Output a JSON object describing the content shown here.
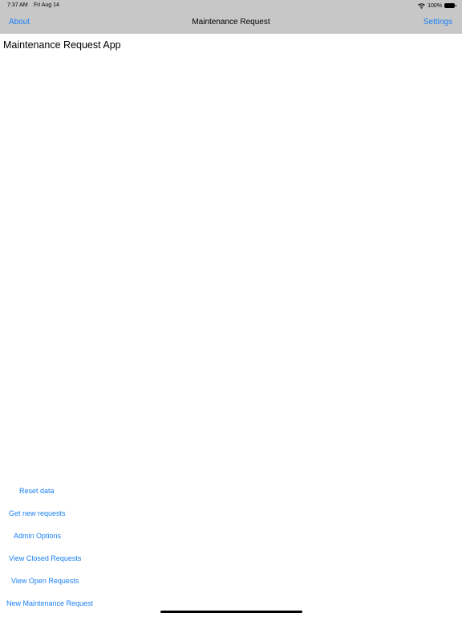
{
  "status_bar": {
    "time": "7:37 AM",
    "date": "Fri Aug 14",
    "battery": "100%",
    "wifi_icon": "wifi-icon",
    "battery_icon": "battery-icon"
  },
  "nav": {
    "left_label": "About",
    "title": "Maintenance Request",
    "right_label": "Settings"
  },
  "main": {
    "heading": "Maintenance Request App"
  },
  "actions": {
    "reset_data": "Reset data",
    "get_new_requests": "Get new requests",
    "admin_options": "Admin Options",
    "view_closed_requests": "View Closed Requests",
    "view_open_requests": "View Open Requests",
    "new_maintenance_request": "New Maintenance Request"
  },
  "colors": {
    "accent": "#1a7ff2",
    "nav_background": "#c7c7c7",
    "background": "#ffffff"
  }
}
